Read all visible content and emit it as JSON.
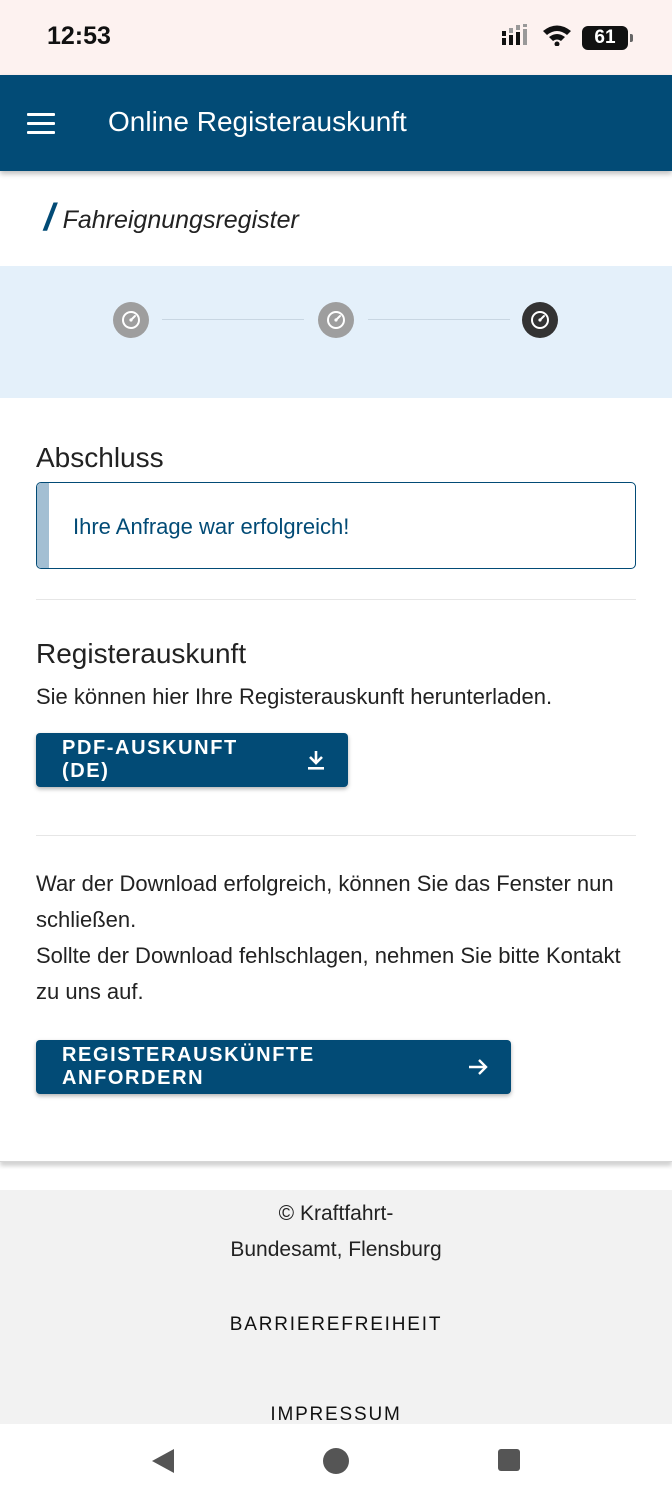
{
  "status_bar": {
    "time": "12:53",
    "battery": "61",
    "icons": [
      "signal-icon",
      "wifi-icon",
      "battery-icon"
    ]
  },
  "app_bar": {
    "title": "Online Registerauskunft",
    "menu_icon": "hamburger-menu-icon",
    "color": "#024b76"
  },
  "breadcrumb": {
    "separator": "/",
    "current": "Fahreignungsregister"
  },
  "stepper": {
    "steps": [
      {
        "icon": "speedometer-icon",
        "state": "done"
      },
      {
        "icon": "speedometer-icon",
        "state": "done"
      },
      {
        "icon": "speedometer-icon",
        "state": "current"
      }
    ],
    "current_step": 3,
    "total_steps": 3
  },
  "abschluss": {
    "heading": "Abschluss",
    "alert_text": "Ihre Anfrage war erfolgreich!"
  },
  "registerauskunft": {
    "heading": "Registerauskunft",
    "description": "Sie können hier Ihre Registerauskunft herunterladen.",
    "download_button": "PDF-AUSKUNFT (DE)",
    "download_icon": "download-icon"
  },
  "info": {
    "line1": "War der Download erfolgreich, können Sie das Fenster nun schließen.",
    "line2": "Sollte der Download fehlschlagen, nehmen Sie bitte Kontakt zu uns auf."
  },
  "request_button": {
    "label": "REGISTERAUSKÜNFTE ANFORDERN",
    "icon": "arrow-right-icon"
  },
  "footer": {
    "copyright_line1": "© Kraftfahrt-",
    "copyright_line2": "Bundesamt, Flensburg",
    "link_accessibility": "BARRIEREFREIHEIT",
    "link_imprint": "IMPRESSUM"
  },
  "nav_bar": {
    "icons": [
      "back-icon",
      "home-icon",
      "recents-icon"
    ]
  }
}
